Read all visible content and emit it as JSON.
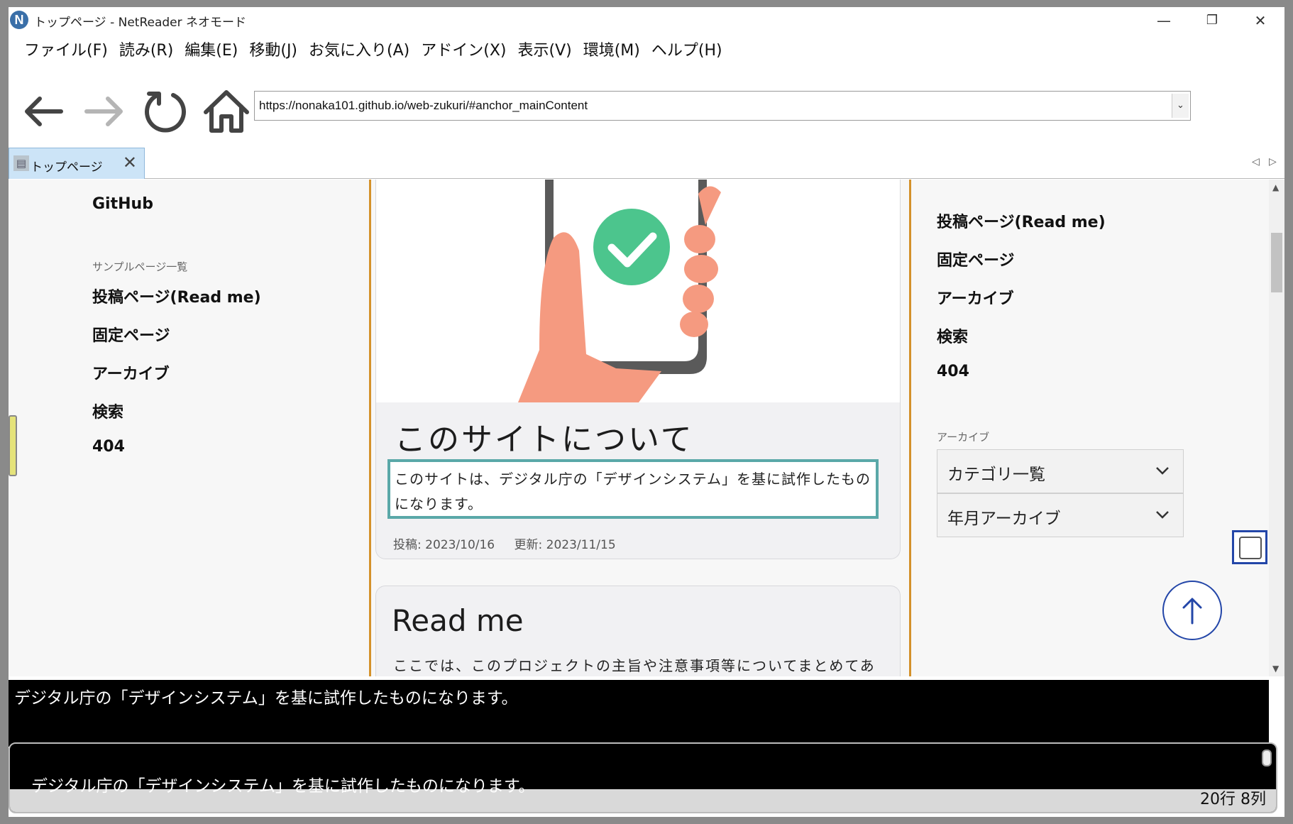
{
  "window": {
    "title": "トップページ - NetReader ネオモード",
    "app_icon": "N",
    "controls": {
      "minimize": "—",
      "maximize": "❐",
      "close": "✕"
    }
  },
  "menu": [
    "ファイル(F)",
    "読み(R)",
    "編集(E)",
    "移動(J)",
    "お気に入り(A)",
    "アドイン(X)",
    "表示(V)",
    "環境(M)",
    "ヘルプ(H)"
  ],
  "toolbar": {
    "url": "https://nonaka101.github.io/web-zukuri/#anchor_mainContent",
    "dropdown_glyph": "⌄"
  },
  "tab": {
    "label": "トップページ",
    "icon": "📄",
    "close": "✕"
  },
  "left_sidebar": {
    "top_link": "GitHub",
    "caption": "サンプルページ一覧",
    "items": [
      "投稿ページ(Read me)",
      "固定ページ",
      "アーカイブ",
      "検索",
      "404"
    ]
  },
  "main": {
    "card1": {
      "title": "このサイトについて",
      "description": "このサイトは、デジタル庁の「デザインシステム」を基に試作したものになります。",
      "posted": "投稿: 2023/10/16",
      "updated": "更新: 2023/11/15"
    },
    "card2": {
      "title": "Read me",
      "text": "ここでは、このプロジェクトの主旨や注意事項等についてまとめてあ"
    }
  },
  "right_sidebar": {
    "items": [
      "投稿ページ(Read me)",
      "固定ページ",
      "アーカイブ",
      "検索",
      "404"
    ],
    "archive_caption": "アーカイブ",
    "accordions": [
      "カテゴリ一覧",
      "年月アーカイブ"
    ]
  },
  "speech": {
    "line1": "デジタル庁の「デザインシステム」を基に試作したものになります。",
    "line2": "デジタル庁の「デザインシステム」を基に試作したものになります。"
  },
  "status": "20行 8列",
  "colors": {
    "accent_border": "#d4912a",
    "focus_box": "#5aa8a8",
    "check_green": "#4cc58d",
    "hand": "#f59a80",
    "phone": "#5a5a5a"
  }
}
